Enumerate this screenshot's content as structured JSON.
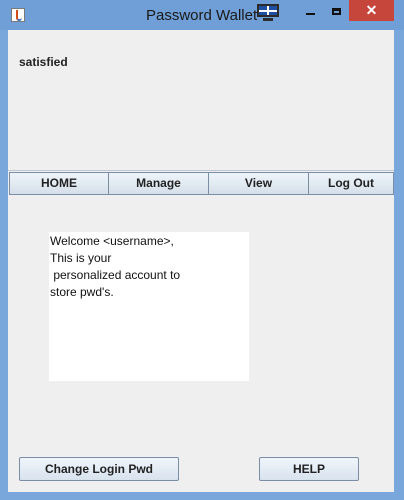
{
  "window": {
    "title": "Password Wallet"
  },
  "status": {
    "text": "satisfied"
  },
  "nav": {
    "home": "HOME",
    "manage": "Manage",
    "view": "View",
    "logout": "Log Out"
  },
  "welcome": {
    "lines": [
      "Welcome <username>,",
      "This is your",
      " personalized account to",
      "store pwd's."
    ]
  },
  "buttons": {
    "change_login_pwd": "Change Login Pwd",
    "help": "HELP"
  },
  "icons": {
    "app": "java-coffee-icon",
    "monitor": "monitor-icon",
    "minimize": "minimize-icon",
    "maximize": "maximize-icon",
    "close": "close-icon"
  },
  "colors": {
    "titlebar": "#6f9fd6",
    "client_bg": "#efefef",
    "close_button": "#c7463b",
    "text_area_bg": "#ffffff"
  }
}
